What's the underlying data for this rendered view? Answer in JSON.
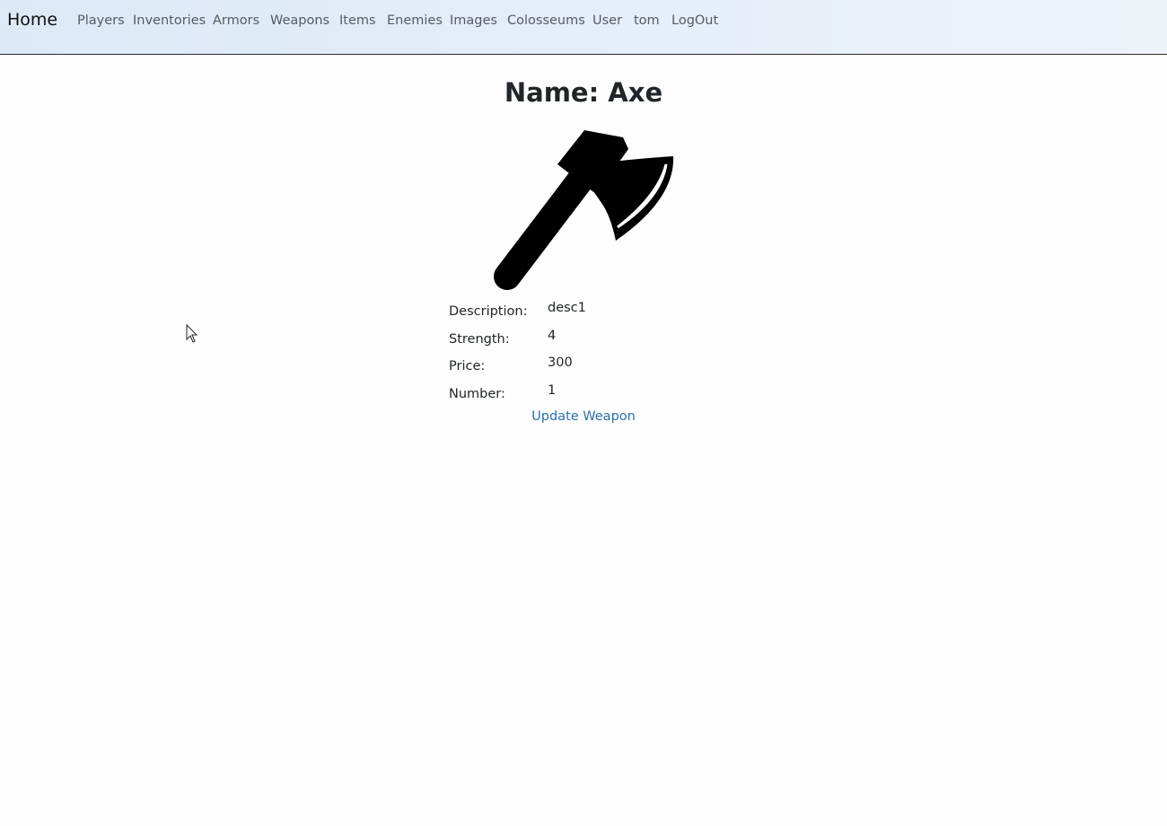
{
  "navbar": {
    "brand": "Home",
    "links": [
      "Players",
      "Inventories",
      "Armors",
      "Weapons",
      "Items",
      "Enemies",
      "Images",
      "Colosseums",
      "User",
      "tom",
      "LogOut"
    ]
  },
  "weapon": {
    "title": "Name: Axe",
    "image_icon": "axe-icon",
    "fields": [
      {
        "label": "Description:",
        "value": "desc1"
      },
      {
        "label": "Strength:",
        "value": "4"
      },
      {
        "label": "Price:",
        "value": "300"
      },
      {
        "label": "Number:",
        "value": "1"
      }
    ],
    "update_label": "Update Weapon"
  },
  "colors": {
    "link": "#2a6fb0",
    "nav_text": "#555b61",
    "navbar_bg": "#dde9f7"
  }
}
